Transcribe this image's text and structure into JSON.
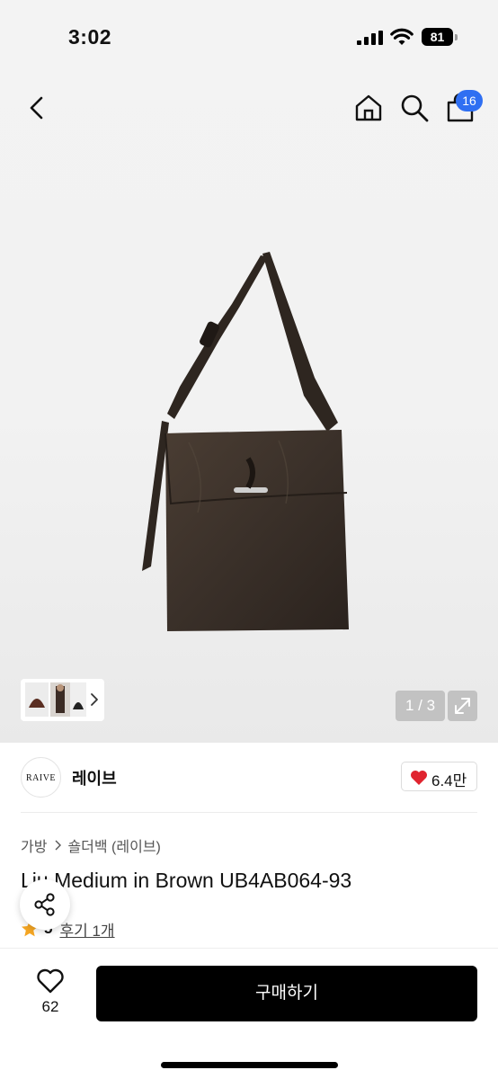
{
  "status_bar": {
    "time": "3:02",
    "battery": "81"
  },
  "nav": {
    "cart_badge": "16"
  },
  "gallery": {
    "counter": "1 / 3"
  },
  "brand": {
    "logo_text": "RAIVE",
    "name": "레이브",
    "likes": "6.4만"
  },
  "breadcrumb": {
    "category": "가방",
    "subcategory": "숄더백 (레이브)"
  },
  "product": {
    "title": "Liu Medium in Brown UB4AB064-93",
    "rating": "5",
    "reviews": "후기 1개"
  },
  "bottom_bar": {
    "wish_count": "62",
    "buy_label": "구매하기"
  },
  "colors": {
    "accent": "#2f6ff2",
    "heart": "#e0242f",
    "star": "#f5a623",
    "bag": "#3a3029"
  },
  "icons": [
    "back-icon",
    "home-icon",
    "search-icon",
    "cart-icon",
    "chevron-right-icon",
    "expand-icon",
    "heart-icon",
    "star-icon",
    "share-icon"
  ]
}
